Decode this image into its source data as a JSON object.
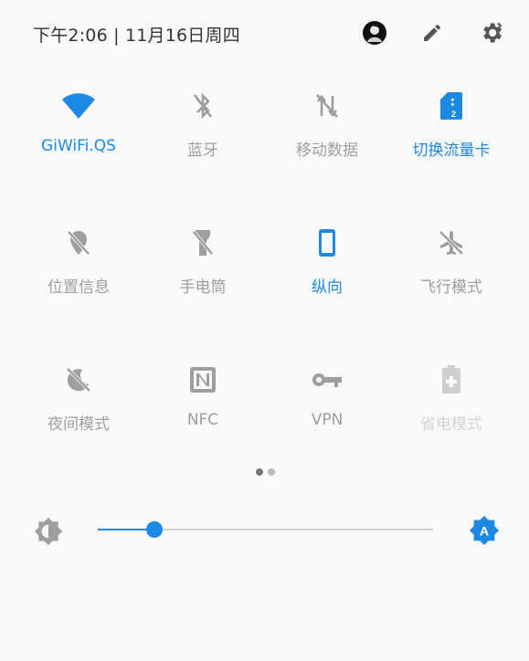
{
  "status": {
    "datetime": "下午2:06 | 11月16日周四"
  },
  "header_icons": [
    "avatar",
    "edit-icon",
    "settings-icon"
  ],
  "tiles": [
    {
      "label": "GiWiFi.QS",
      "icon": "wifi-icon",
      "state": "on"
    },
    {
      "label": "蓝牙",
      "icon": "bluetooth-off-icon",
      "state": "off"
    },
    {
      "label": "移动数据",
      "icon": "mobile-data-off-icon",
      "state": "off"
    },
    {
      "label": "切换流量卡",
      "icon": "sim-card-icon",
      "state": "on"
    },
    {
      "label": "位置信息",
      "icon": "location-off-icon",
      "state": "off"
    },
    {
      "label": "手电筒",
      "icon": "flashlight-off-icon",
      "state": "off"
    },
    {
      "label": "纵向",
      "icon": "portrait-icon",
      "state": "on"
    },
    {
      "label": "飞行模式",
      "icon": "airplane-off-icon",
      "state": "off"
    },
    {
      "label": "夜间模式",
      "icon": "night-mode-off-icon",
      "state": "off"
    },
    {
      "label": "NFC",
      "icon": "nfc-icon",
      "state": "off"
    },
    {
      "label": "VPN",
      "icon": "vpn-key-icon",
      "state": "off"
    },
    {
      "label": "省电模式",
      "icon": "battery-saver-icon",
      "state": "disabled"
    }
  ],
  "pager": {
    "pages": 2,
    "current": 1
  },
  "brightness": {
    "level": 0.17,
    "auto": true,
    "auto_label": "A"
  },
  "colors": {
    "accent": "#1e88e5",
    "inactive": "#9e9e9e",
    "disabled": "#d3d3d3"
  }
}
